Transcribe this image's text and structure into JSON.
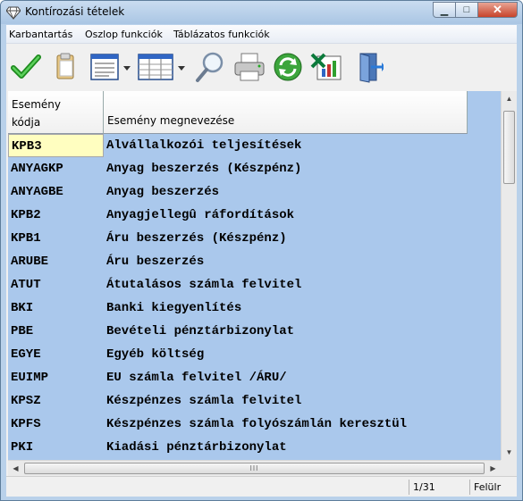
{
  "window": {
    "title": "Kontírozási tételek",
    "close_glyph": "✕",
    "minimize_glyph": "▁",
    "maximize_glyph": "□"
  },
  "menu": [
    "Karbantartás",
    "Oszlop funkciók",
    "Táblázatos funkciók"
  ],
  "toolbar": [
    {
      "name": "ok-check-icon",
      "icon": "checkmark"
    },
    {
      "name": "clipboard-icon",
      "icon": "clipboard"
    },
    {
      "name": "document-view-icon",
      "icon": "document-list"
    },
    {
      "name": "table-view-icon",
      "icon": "table"
    },
    {
      "name": "search-icon",
      "icon": "magnifier"
    },
    {
      "name": "print-icon",
      "icon": "printer"
    },
    {
      "name": "refresh-icon",
      "icon": "refresh"
    },
    {
      "name": "excel-export-icon",
      "icon": "excel-chart"
    },
    {
      "name": "exit-door-icon",
      "icon": "door-exit"
    }
  ],
  "table": {
    "headers": {
      "code_line1": "Esemény",
      "code_line2": "kódja",
      "name": "Esemény megnevezése"
    },
    "rows": [
      {
        "code": "KPB3",
        "name": "Alvállalkozói teljesítések"
      },
      {
        "code": "ANYAGKP",
        "name": "Anyag beszerzés (Készpénz)"
      },
      {
        "code": "ANYAGBE",
        "name": "Anyag beszerzés"
      },
      {
        "code": "KPB2",
        "name": "Anyagjellegû ráfordítások"
      },
      {
        "code": "KPB1",
        "name": "Áru beszerzés (Készpénz)"
      },
      {
        "code": "ARUBE",
        "name": "Áru beszerzés"
      },
      {
        "code": "ATUT",
        "name": "Átutalásos számla felvitel"
      },
      {
        "code": "BKI",
        "name": "Banki kiegyenlítés"
      },
      {
        "code": "PBE",
        "name": "Bevételi pénztárbizonylat"
      },
      {
        "code": "EGYE",
        "name": "Egyéb költség"
      },
      {
        "code": "EUIMP",
        "name": "EU számla felvitel /ÁRU/"
      },
      {
        "code": "KPSZ",
        "name": "Készpénzes számla felvitel"
      },
      {
        "code": "KPFS",
        "name": "Készpénzes számla folyószámlán keresztül"
      },
      {
        "code": "PKI",
        "name": "Kiadási pénztárbizonylat"
      }
    ]
  },
  "scrollbars": {
    "up": "▲",
    "down": "▼",
    "left": "◀",
    "right": "▶",
    "grip": "III"
  },
  "status": {
    "position": "1/31",
    "mode": "Felülr"
  },
  "colors": {
    "grid_bg": "#aac8ec",
    "selected_cell": "#fffec0"
  }
}
